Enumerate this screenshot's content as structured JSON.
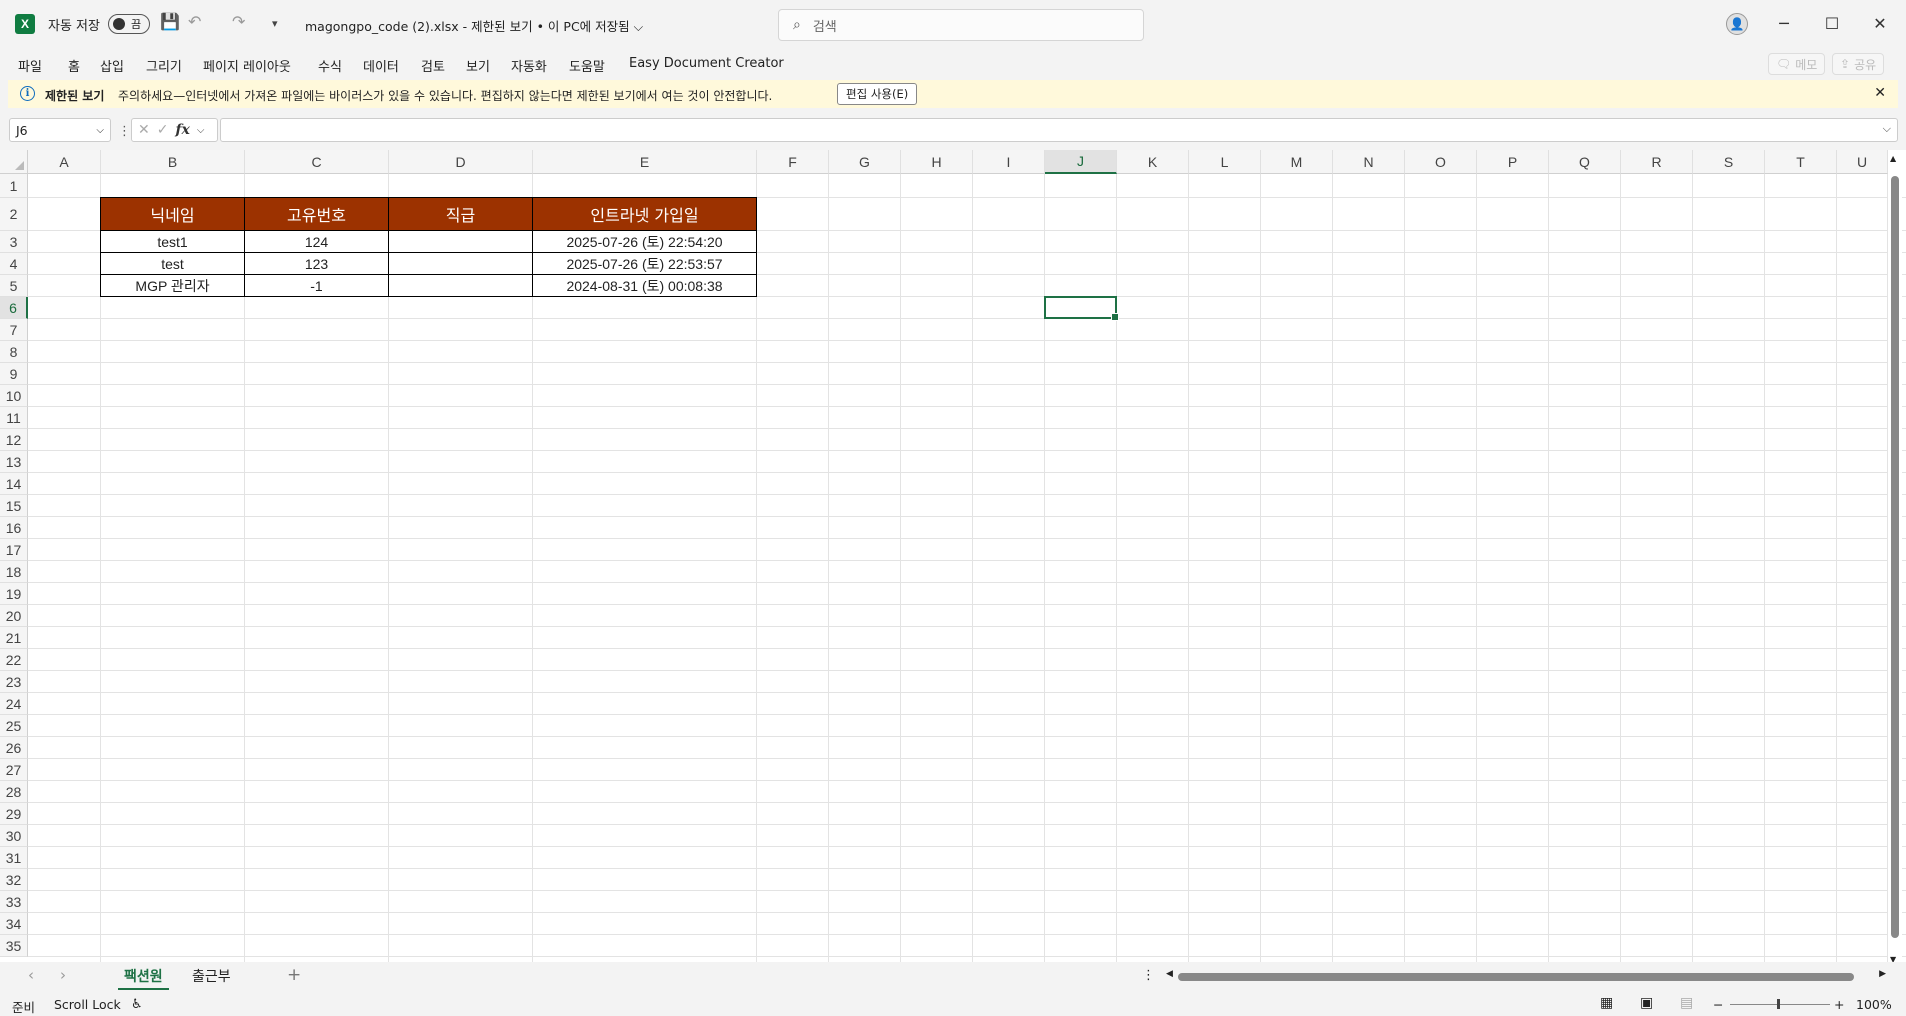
{
  "titlebar": {
    "autosave_label": "자동 저장",
    "autosave_state": "끔",
    "doc_title": "magongpo_code (2).xlsx  -  제한된 보기 • 이 PC에 저장됨 ⌵",
    "search_placeholder": "검색",
    "win_minimize": "─",
    "win_restore": "☐",
    "win_close": "✕"
  },
  "menu": {
    "items": [
      "파일",
      "홈",
      "삽입",
      "그리기",
      "페이지 레이아웃",
      "수식",
      "데이터",
      "검토",
      "보기",
      "자동화",
      "도움말",
      "Easy Document Creator"
    ],
    "memo_label": "메모",
    "share_label": "공유"
  },
  "message_bar": {
    "title": "제한된 보기",
    "text": "주의하세요—인터넷에서 가져온 파일에는 바이러스가 있을 수 있습니다. 편집하지 않는다면 제한된 보기에서 여는 것이 안전합니다.",
    "enable_button": "편집 사용(E)"
  },
  "formula_bar": {
    "name_box": "J6",
    "fx_label": "fx",
    "formula": ""
  },
  "grid": {
    "columns": [
      "A",
      "B",
      "C",
      "D",
      "E",
      "F",
      "G",
      "H",
      "I",
      "J",
      "K",
      "L",
      "M",
      "N",
      "O",
      "P",
      "Q",
      "R",
      "S",
      "T",
      "U"
    ],
    "selected_column": "J",
    "rows": [
      "1",
      "2",
      "3",
      "4",
      "5",
      "6",
      "7",
      "8",
      "9",
      "10",
      "11",
      "12",
      "13",
      "14",
      "15",
      "16",
      "17",
      "18",
      "19",
      "20",
      "21",
      "22",
      "23",
      "24",
      "25",
      "26",
      "27",
      "28",
      "29",
      "30",
      "31",
      "32",
      "33",
      "34",
      "35"
    ],
    "selected_row": "6"
  },
  "table": {
    "header_color": "#9c3200",
    "headers": [
      "닉네임",
      "고유번호",
      "직급",
      "인트라넷 가입일"
    ],
    "rows": [
      [
        "test1",
        "124",
        "",
        "2025-07-26 (토) 22:54:20"
      ],
      [
        "test",
        "123",
        "",
        "2025-07-26 (토) 22:53:57"
      ],
      [
        "MGP 관리자",
        "-1",
        "",
        "2024-08-31 (토) 00:08:38"
      ]
    ]
  },
  "sheets": {
    "tabs": [
      "팩션원",
      "출근부"
    ],
    "active": "팩션원"
  },
  "status": {
    "ready": "준비",
    "scroll_lock": "Scroll Lock",
    "zoom": "100%"
  },
  "accent_color": "#1e7145"
}
